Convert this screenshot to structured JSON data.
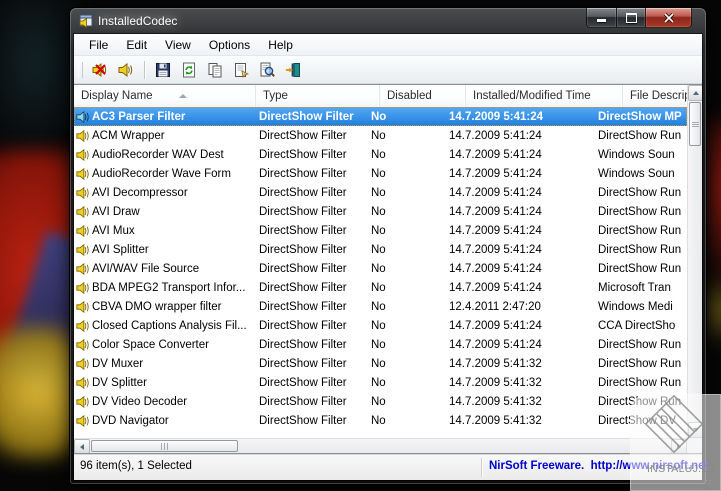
{
  "window": {
    "title": "InstalledCodec"
  },
  "menu": {
    "items": [
      {
        "label": "File"
      },
      {
        "label": "Edit"
      },
      {
        "label": "View"
      },
      {
        "label": "Options"
      },
      {
        "label": "Help"
      }
    ]
  },
  "toolbar": {
    "buttons": [
      {
        "name": "disable-selected",
        "icon": "speaker-mute-icon"
      },
      {
        "name": "enable-selected",
        "icon": "speaker-icon"
      },
      {
        "name": "save",
        "icon": "floppy-icon"
      },
      {
        "name": "refresh",
        "icon": "refresh-icon"
      },
      {
        "name": "copy",
        "icon": "copy-icon"
      },
      {
        "name": "properties",
        "icon": "properties-icon"
      },
      {
        "name": "find",
        "icon": "find-icon"
      },
      {
        "name": "exit",
        "icon": "exit-door-icon"
      }
    ]
  },
  "table": {
    "columns": [
      {
        "label": "Display Name"
      },
      {
        "label": "Type"
      },
      {
        "label": "Disabled"
      },
      {
        "label": "Installed/Modified Time"
      },
      {
        "label": "File Description"
      }
    ],
    "sort_column": "Display Name",
    "sort_order": "ascending",
    "rows": [
      {
        "name": "AC3 Parser Filter",
        "type": "DirectShow Filter",
        "disabled": "No",
        "time": "14.7.2009 5:41:24",
        "desc": "DirectShow MP",
        "selected": true
      },
      {
        "name": "ACM Wrapper",
        "type": "DirectShow Filter",
        "disabled": "No",
        "time": "14.7.2009 5:41:24",
        "desc": "DirectShow Run",
        "selected": false
      },
      {
        "name": "AudioRecorder WAV Dest",
        "type": "DirectShow Filter",
        "disabled": "No",
        "time": "14.7.2009 5:41:24",
        "desc": "Windows Soun",
        "selected": false
      },
      {
        "name": "AudioRecorder Wave Form",
        "type": "DirectShow Filter",
        "disabled": "No",
        "time": "14.7.2009 5:41:24",
        "desc": "Windows Soun",
        "selected": false
      },
      {
        "name": "AVI Decompressor",
        "type": "DirectShow Filter",
        "disabled": "No",
        "time": "14.7.2009 5:41:24",
        "desc": "DirectShow Run",
        "selected": false
      },
      {
        "name": "AVI Draw",
        "type": "DirectShow Filter",
        "disabled": "No",
        "time": "14.7.2009 5:41:24",
        "desc": "DirectShow Run",
        "selected": false
      },
      {
        "name": "AVI Mux",
        "type": "DirectShow Filter",
        "disabled": "No",
        "time": "14.7.2009 5:41:24",
        "desc": "DirectShow Run",
        "selected": false
      },
      {
        "name": "AVI Splitter",
        "type": "DirectShow Filter",
        "disabled": "No",
        "time": "14.7.2009 5:41:24",
        "desc": "DirectShow Run",
        "selected": false
      },
      {
        "name": "AVI/WAV File Source",
        "type": "DirectShow Filter",
        "disabled": "No",
        "time": "14.7.2009 5:41:24",
        "desc": "DirectShow Run",
        "selected": false
      },
      {
        "name": "BDA MPEG2 Transport Infor...",
        "type": "DirectShow Filter",
        "disabled": "No",
        "time": "14.7.2009 5:41:24",
        "desc": "Microsoft Tran",
        "selected": false
      },
      {
        "name": "CBVA DMO wrapper filter",
        "type": "DirectShow Filter",
        "disabled": "No",
        "time": "12.4.2011 2:47:20",
        "desc": "Windows Medi",
        "selected": false
      },
      {
        "name": "Closed Captions Analysis Fil...",
        "type": "DirectShow Filter",
        "disabled": "No",
        "time": "14.7.2009 5:41:24",
        "desc": "CCA DirectSho",
        "selected": false
      },
      {
        "name": "Color Space Converter",
        "type": "DirectShow Filter",
        "disabled": "No",
        "time": "14.7.2009 5:41:24",
        "desc": "DirectShow Run",
        "selected": false
      },
      {
        "name": "DV Muxer",
        "type": "DirectShow Filter",
        "disabled": "No",
        "time": "14.7.2009 5:41:32",
        "desc": "DirectShow Run",
        "selected": false
      },
      {
        "name": "DV Splitter",
        "type": "DirectShow Filter",
        "disabled": "No",
        "time": "14.7.2009 5:41:32",
        "desc": "DirectShow Run",
        "selected": false
      },
      {
        "name": "DV Video Decoder",
        "type": "DirectShow Filter",
        "disabled": "No",
        "time": "14.7.2009 5:41:32",
        "desc": "DirectShow Run",
        "selected": false
      },
      {
        "name": "DVD Navigator",
        "type": "DirectShow Filter",
        "disabled": "No",
        "time": "14.7.2009 5:41:32",
        "desc": "DirectShow DV",
        "selected": false
      }
    ]
  },
  "status": {
    "items_text": "96 item(s), 1 Selected",
    "freeware_text": "NirSoft Freeware.  http://www.nirsoft.net"
  },
  "desktop": {
    "watermark_label": "INSTALUJ.CZ",
    "watermark_dots": ".::"
  },
  "colors": {
    "selection": "#2f8ee9",
    "link_blue": "#0000cc",
    "close_button_red": "#a83a2a"
  }
}
